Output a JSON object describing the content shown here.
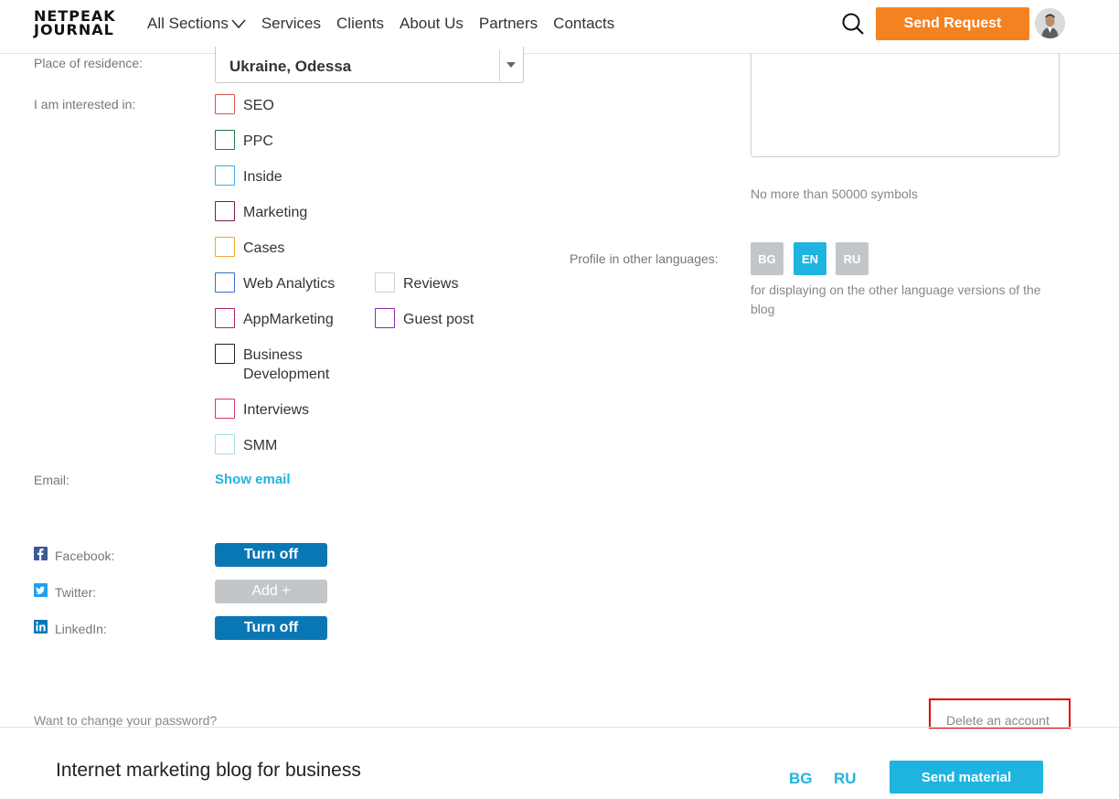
{
  "header": {
    "logo_line1": "NETPEAK",
    "logo_line2": "JOURNAL",
    "nav": [
      "All Sections",
      "Services",
      "Clients",
      "About Us",
      "Partners",
      "Contacts"
    ],
    "send_request": "Send Request"
  },
  "profile": {
    "residence_label": "Place of residence:",
    "residence_value": "Ukraine, Odessa",
    "interests_label": "I am interested in:",
    "interests": {
      "seo": "SEO",
      "ppc": "PPC",
      "inside": "Inside",
      "marketing": "Marketing",
      "cases": "Cases",
      "web_analytics": "Web Analytics",
      "reviews": "Reviews",
      "appmarketing": "AppMarketing",
      "guest_post": "Guest post",
      "business_development": "Business Development",
      "interviews": "Interviews",
      "smm": "SMM"
    },
    "interest_colors": {
      "seo": "#d9534f",
      "ppc": "#1e7a4a",
      "inside": "#3bb3d6",
      "marketing": "#7a1a5a",
      "cases": "#f0a830",
      "web_analytics": "#3a6cc8",
      "reviews": "#d0d0d0",
      "appmarketing": "#b01f6a",
      "guest_post": "#8a2bb0",
      "business_development": "#222222",
      "interviews": "#d6337a",
      "smm": "#a8d8ea"
    },
    "email_label": "Email:",
    "show_email": "Show email",
    "social": {
      "facebook_label": "Facebook:",
      "facebook_btn": "Turn off",
      "twitter_label": "Twitter:",
      "twitter_btn": "Add +",
      "linkedin_label": "LinkedIn:",
      "linkedin_btn": "Turn off"
    },
    "change_password": "Want to change your password?",
    "delete_account": "Delete an account"
  },
  "right": {
    "symbols_note": "No more than 50000 symbols",
    "other_languages_label": "Profile in other languages:",
    "languages": [
      "BG",
      "EN",
      "RU"
    ],
    "languages_note": "for displaying on the other language versions of the blog"
  },
  "footer": {
    "title": "Internet marketing blog for business",
    "langs": [
      "BG",
      "RU"
    ],
    "send_material": "Send material"
  },
  "colors": {
    "accent_orange": "#f58220",
    "accent_blue": "#1fb4df",
    "social_blue": "#0a77b5",
    "disabled_gray": "#c3c6c8"
  }
}
